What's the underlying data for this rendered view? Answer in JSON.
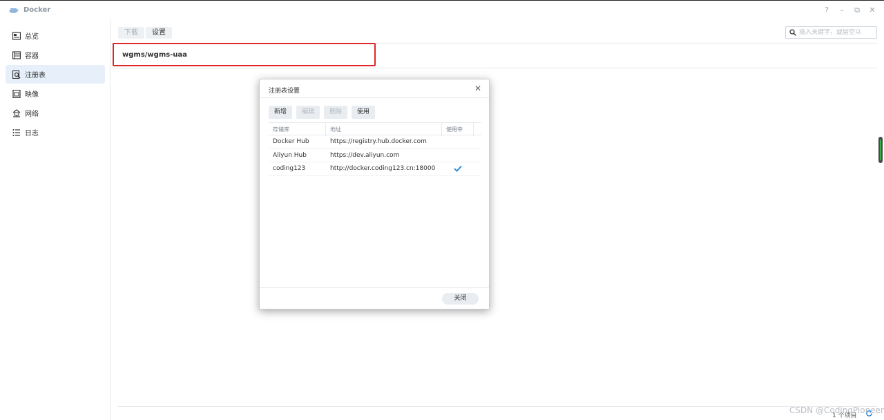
{
  "app": {
    "title": "Docker"
  },
  "window_controls": {
    "help": "?",
    "minimize": "–",
    "restore": "⧉",
    "close": "✕"
  },
  "sidebar": {
    "items": [
      {
        "label": "总览",
        "icon": "overview-icon"
      },
      {
        "label": "容器",
        "icon": "container-icon"
      },
      {
        "label": "注册表",
        "icon": "registry-icon",
        "active": true
      },
      {
        "label": "映像",
        "icon": "image-icon"
      },
      {
        "label": "网络",
        "icon": "network-icon"
      },
      {
        "label": "日志",
        "icon": "log-icon"
      }
    ]
  },
  "toolbar": {
    "download_label": "下载",
    "settings_label": "设置"
  },
  "search": {
    "placeholder": "插入关键字，或留空以"
  },
  "repo": {
    "name": "wgms/wgms-uaa"
  },
  "footer": {
    "count": "1 个项目"
  },
  "watermark": "CSDN @CodingPioneer",
  "dialog": {
    "title": "注册表设置",
    "close_icon": "✕",
    "buttons": {
      "add": "新增",
      "edit": "编辑",
      "delete": "删除",
      "use": "使用"
    },
    "columns": {
      "repo": "存储库",
      "address": "地址",
      "in_use": "使用中"
    },
    "rows": [
      {
        "repo": "Docker Hub",
        "address": "https://registry.hub.docker.com",
        "in_use": false
      },
      {
        "repo": "Aliyun Hub",
        "address": "https://dev.aliyun.com",
        "in_use": false
      },
      {
        "repo": "coding123",
        "address": "http://docker.coding123.cn:18000",
        "in_use": true
      }
    ],
    "close_label": "关闭"
  },
  "colors": {
    "highlight": "#e0262a",
    "active_nav": "#e7f0fa",
    "check": "#1f7fd8"
  }
}
